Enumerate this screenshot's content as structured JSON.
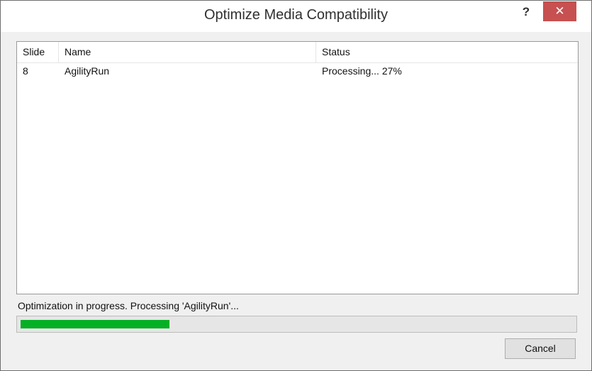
{
  "window": {
    "title": "Optimize Media Compatibility",
    "help_label": "?",
    "close_label": "✕"
  },
  "list": {
    "columns": [
      "Slide",
      "Name",
      "Status"
    ],
    "rows": [
      {
        "slide": "8",
        "name": "AgilityRun",
        "status": "Processing... 27%"
      }
    ]
  },
  "progress": {
    "message": "Optimization in progress. Processing 'AgilityRun'...",
    "fraction": 0.27,
    "color": "#06b025"
  },
  "buttons": {
    "cancel_label": "Cancel"
  }
}
